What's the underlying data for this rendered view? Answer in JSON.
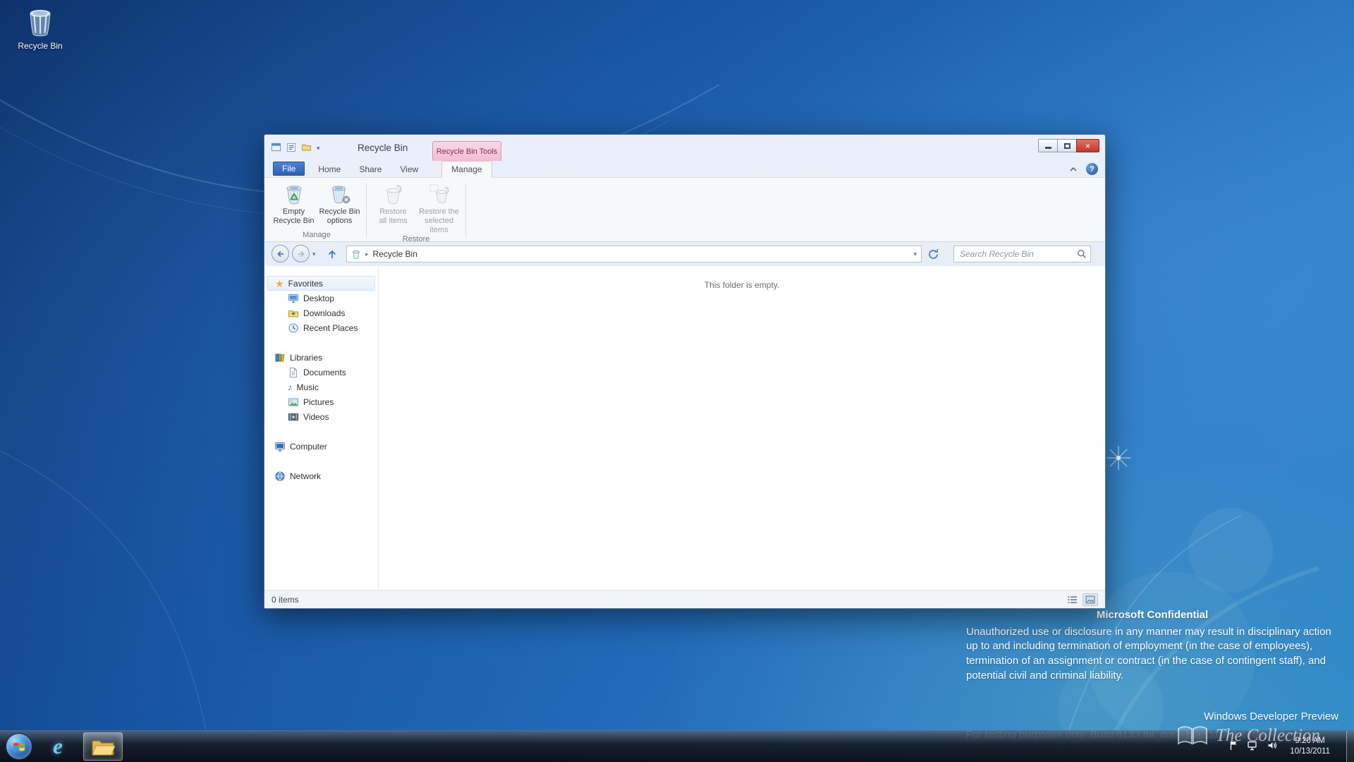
{
  "colors": {
    "desktop_blue": "#1f67b6",
    "contextual_tab_pink": "#f3bcd3",
    "file_tab_blue": "#3d6fc4",
    "close_button_red": "#c0392e",
    "taskbar_dark": "#14181f"
  },
  "desktop": {
    "recycle_bin_label": "Recycle Bin"
  },
  "explorer": {
    "title": "Recycle Bin",
    "contextual_tab": "Recycle Bin Tools",
    "tabs": {
      "file": "File",
      "home": "Home",
      "share": "Share",
      "view": "View",
      "manage": "Manage"
    },
    "ribbon": {
      "empty_button": "Empty\nRecycle Bin",
      "options_button": "Recycle Bin\noptions",
      "restore_all_button": "Restore\nall items",
      "restore_selected_button": "Restore the\nselected items",
      "group_manage": "Manage",
      "group_restore": "Restore"
    },
    "address": {
      "location": "Recycle Bin"
    },
    "search_placeholder": "Search Recycle Bin",
    "sidebar": {
      "favorites_label": "Favorites",
      "favorites": [
        "Desktop",
        "Downloads",
        "Recent Places"
      ],
      "libraries_label": "Libraries",
      "libraries": [
        "Documents",
        "Music",
        "Pictures",
        "Videos"
      ],
      "computer_label": "Computer",
      "network_label": "Network"
    },
    "content": {
      "empty_message": "This folder is empty."
    },
    "status": {
      "count": "0 items"
    }
  },
  "watermark": {
    "title": "Microsoft Confidential",
    "body": "Unauthorized use or disclosure in any manner may result in disciplinary action up to and including termination of employment (in the case of employees), termination of an assignment or contract (in the case of contingent staff), and potential civil and criminal liability.",
    "edition": "Windows Developer Preview",
    "build": "For testing purposes only. Build 8133.fbl_dnt2_bui.111013-1700"
  },
  "site_watermark": {
    "text": "The Collection"
  },
  "taskbar": {
    "time": "9:20 AM",
    "date": "10/13/2011"
  }
}
